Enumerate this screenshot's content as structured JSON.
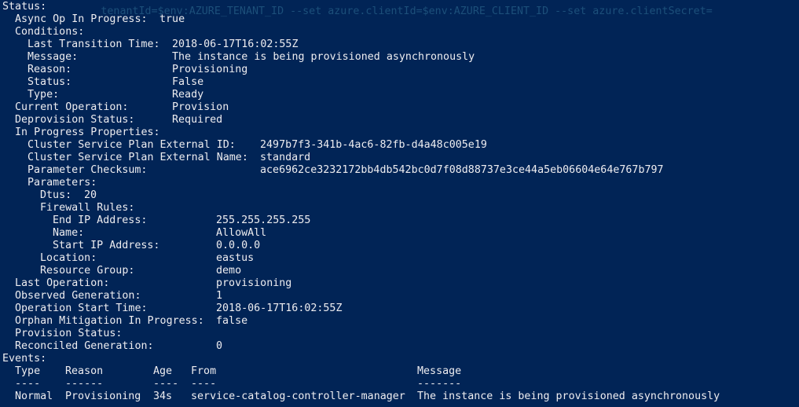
{
  "window": {
    "ghost_command_top": "                tenantId=$env:AZURE_TENANT_ID --set azure.clientId=$env:AZURE_CLIENT_ID --set azure.clientSecret=",
    "ghost_command_bottom": "                                                              "
  },
  "status": {
    "header": "Status:",
    "async_op": {
      "label": "Async Op In Progress:",
      "value": "true"
    },
    "conditions": {
      "header": "Conditions:",
      "last_transition_time": {
        "label": "Last Transition Time:",
        "value": "2018-06-17T16:02:55Z"
      },
      "message": {
        "label": "Message:",
        "value": "The instance is being provisioned asynchronously"
      },
      "reason": {
        "label": "Reason:",
        "value": "Provisioning"
      },
      "status": {
        "label": "Status:",
        "value": "False"
      },
      "type": {
        "label": "Type:",
        "value": "Ready"
      }
    },
    "current_operation": {
      "label": "Current Operation:",
      "value": "Provision"
    },
    "deprovision_status": {
      "label": "Deprovision Status:",
      "value": "Required"
    },
    "in_progress_properties": {
      "header": "In Progress Properties:",
      "cluster_service_plan_external_id": {
        "label": "Cluster Service Plan External ID:",
        "value": "2497b7f3-341b-4ac6-82fb-d4a48c005e19"
      },
      "cluster_service_plan_external_name": {
        "label": "Cluster Service Plan External Name:",
        "value": "standard"
      },
      "parameter_checksum": {
        "label": "Parameter Checksum:",
        "value": "ace6962ce3232172bb4db542bc0d7f08d88737e3ce44a5eb06604e64e767b797"
      },
      "parameters": {
        "header": "Parameters:",
        "dtus": {
          "label": "Dtus:",
          "value": "20"
        },
        "firewall_rules": {
          "header": "Firewall Rules:",
          "end_ip": {
            "label": "End IP Address:",
            "value": "255.255.255.255"
          },
          "name": {
            "label": "Name:",
            "value": "AllowAll"
          },
          "start_ip": {
            "label": "Start IP Address:",
            "value": "0.0.0.0"
          }
        },
        "location": {
          "label": "Location:",
          "value": "eastus"
        },
        "resource_group": {
          "label": "Resource Group:",
          "value": "demo"
        }
      }
    },
    "last_operation": {
      "label": "Last Operation:",
      "value": "provisioning"
    },
    "observed_generation": {
      "label": "Observed Generation:",
      "value": "1"
    },
    "operation_start_time": {
      "label": "Operation Start Time:",
      "value": "2018-06-17T16:02:55Z"
    },
    "orphan_mitigation": {
      "label": "Orphan Mitigation In Progress:",
      "value": "false"
    },
    "provision_status": {
      "label": "Provision Status:",
      "value": ""
    },
    "reconciled_generation": {
      "label": "Reconciled Generation:",
      "value": "0"
    }
  },
  "events": {
    "header": "Events:",
    "columns": [
      "Type",
      "Reason",
      "Age",
      "From",
      "Message"
    ],
    "separators": [
      "----",
      "------",
      "----",
      "----",
      "-------"
    ],
    "rows": [
      {
        "type": "Normal",
        "reason": "Provisioning",
        "age": "34s",
        "from": "service-catalog-controller-manager",
        "message": "The instance is being provisioned asynchronously"
      }
    ]
  },
  "colors": {
    "background": "#012456",
    "foreground": "#eeedf0",
    "ghost_text": "#1c4f7a"
  }
}
